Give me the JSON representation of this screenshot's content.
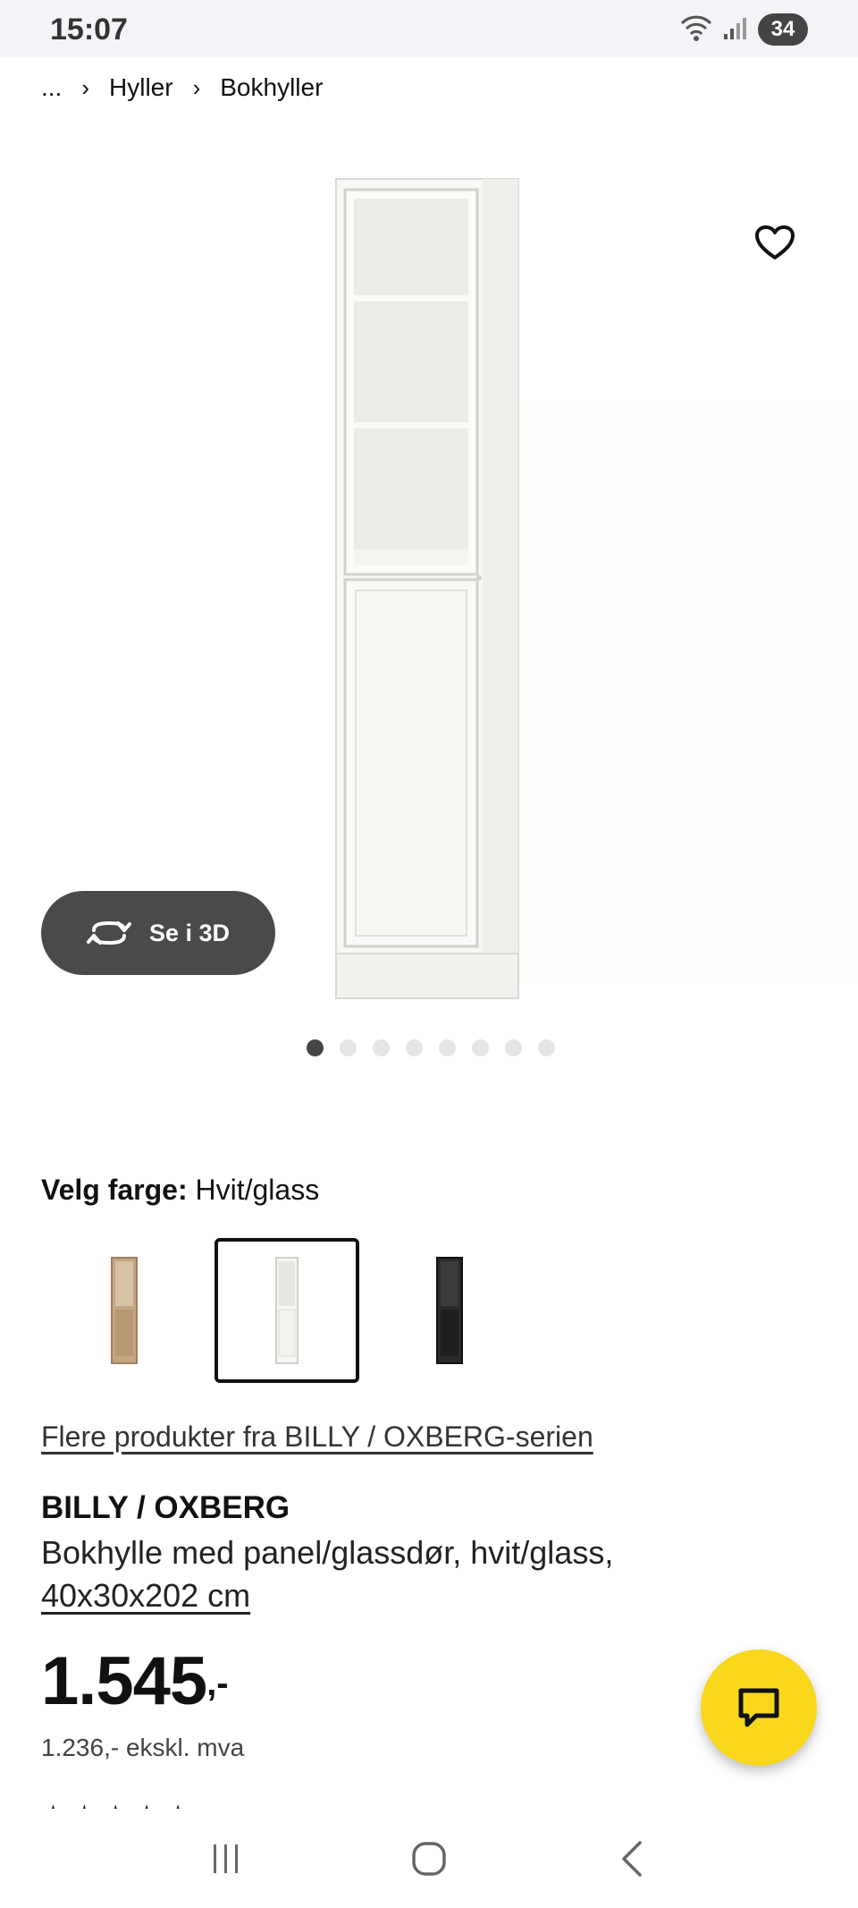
{
  "status_bar": {
    "time": "15:07",
    "battery": "34",
    "wifi_label": "5"
  },
  "breadcrumb": {
    "ellipsis": "...",
    "items": [
      "Hyller",
      "Bokhyller"
    ]
  },
  "gallery": {
    "button_3d_label": "Se i 3D",
    "dot_count": 8,
    "active_dot": 0
  },
  "color": {
    "label": "Velg farge:",
    "value": "Hvit/glass",
    "swatches": [
      {
        "name": "oak",
        "color": "#b89b78",
        "selected": false
      },
      {
        "name": "white",
        "color": "#f2f2ee",
        "selected": true
      },
      {
        "name": "black",
        "color": "#2a2a2a",
        "selected": false
      }
    ]
  },
  "series_link": "Flere produkter fra BILLY / OXBERG-serien",
  "product": {
    "name": "BILLY / OXBERG",
    "description": "Bokhylle med panel/glassdør, hvit/glass,",
    "dimensions": "40x30x202 cm",
    "price": "1.545",
    "price_suffix": ",-",
    "price_ex_vat": "1.236,- ekskl. mva"
  },
  "colors": {
    "accent_yellow": "#f8d71c",
    "dark_button": "#4a4a4a"
  }
}
